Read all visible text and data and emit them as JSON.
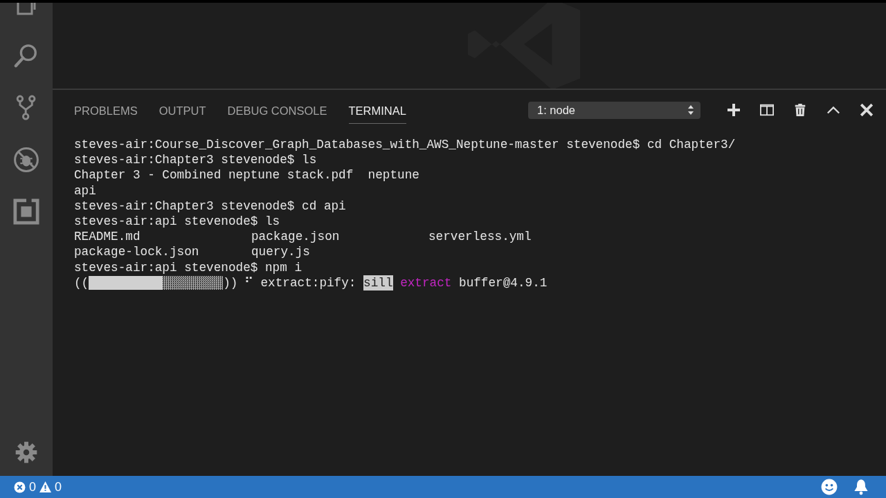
{
  "panel": {
    "tabs": [
      {
        "label": "PROBLEMS",
        "selected": false
      },
      {
        "label": "OUTPUT",
        "selected": false
      },
      {
        "label": "DEBUG CONSOLE",
        "selected": false
      },
      {
        "label": "TERMINAL",
        "selected": true
      }
    ],
    "terminal_select": {
      "value": "1: node"
    }
  },
  "terminal": {
    "lines": [
      {
        "kind": "text",
        "text": "steves-air:Course_Discover_Graph_Databases_with_AWS_Neptune-master stevenode$ cd Chapter3/"
      },
      {
        "kind": "text",
        "text": "steves-air:Chapter3 stevenode$ ls"
      },
      {
        "kind": "text",
        "text": "Chapter 3 - Combined neptune stack.pdf  neptune"
      },
      {
        "kind": "text",
        "text": "api"
      },
      {
        "kind": "text",
        "text": "steves-air:Chapter3 stevenode$ cd api"
      },
      {
        "kind": "text",
        "text": "steves-air:api stevenode$ ls"
      },
      {
        "kind": "columns",
        "cells": [
          "README.md",
          "package.json",
          "serverless.yml"
        ]
      },
      {
        "kind": "columns",
        "cells": [
          "package-lock.json",
          "query.js"
        ]
      },
      {
        "kind": "text",
        "text": "steves-air:api stevenode$ npm i"
      },
      {
        "kind": "progress",
        "open": "((",
        "close": "))",
        "level": 0.55,
        "spinner": "⠋",
        "segments": [
          {
            "kind": "text",
            "text": "extract:pify:"
          },
          {
            "kind": "level",
            "text": "sill"
          },
          {
            "kind": "action",
            "text": "extract"
          },
          {
            "kind": "text",
            "text": "buffer@4.9.1"
          }
        ]
      }
    ]
  },
  "status_bar": {
    "errors": "0",
    "warnings": "0"
  }
}
